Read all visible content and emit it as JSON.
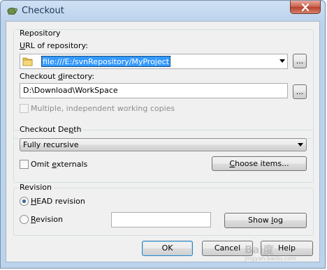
{
  "window": {
    "title": "Checkout"
  },
  "repository": {
    "group_title": "Repository",
    "url_label_u": "U",
    "url_label_rest": "RL of repository:",
    "url_value": "file:///E:/svnRepository/MyProject",
    "url_browse": "...",
    "dir_label_pre": "Checkout ",
    "dir_label_u": "d",
    "dir_label_rest": "irectory:",
    "dir_value": "D:\\Download\\WorkSpace",
    "dir_browse": "...",
    "multiple_label": "Multiple, independent working copies",
    "multiple_checked": false
  },
  "depth": {
    "group_title_pre": "Checkout De",
    "group_title_u": "p",
    "group_title_rest": "th",
    "selected": "Fully recursive",
    "omit_pre": "Omit ",
    "omit_u": "e",
    "omit_rest": "xternals",
    "omit_checked": false,
    "choose_pre": "",
    "choose_u": "C",
    "choose_rest": "hoose items..."
  },
  "revision": {
    "group_title": "Revision",
    "head_u": "H",
    "head_rest": "EAD revision",
    "head_selected": true,
    "rev_u": "R",
    "rev_rest": "evision",
    "rev_selected": false,
    "rev_value": "",
    "showlog_pre": "Show ",
    "showlog_u": "l",
    "showlog_rest": "og"
  },
  "footer": {
    "ok": "OK",
    "cancel": "Cancel",
    "help": "Help"
  },
  "watermark": {
    "text": "Bai度",
    "sub": "jingyan.baidu.com"
  },
  "colors": {
    "selection": "#3399ff",
    "title_text": "#1e395b"
  }
}
